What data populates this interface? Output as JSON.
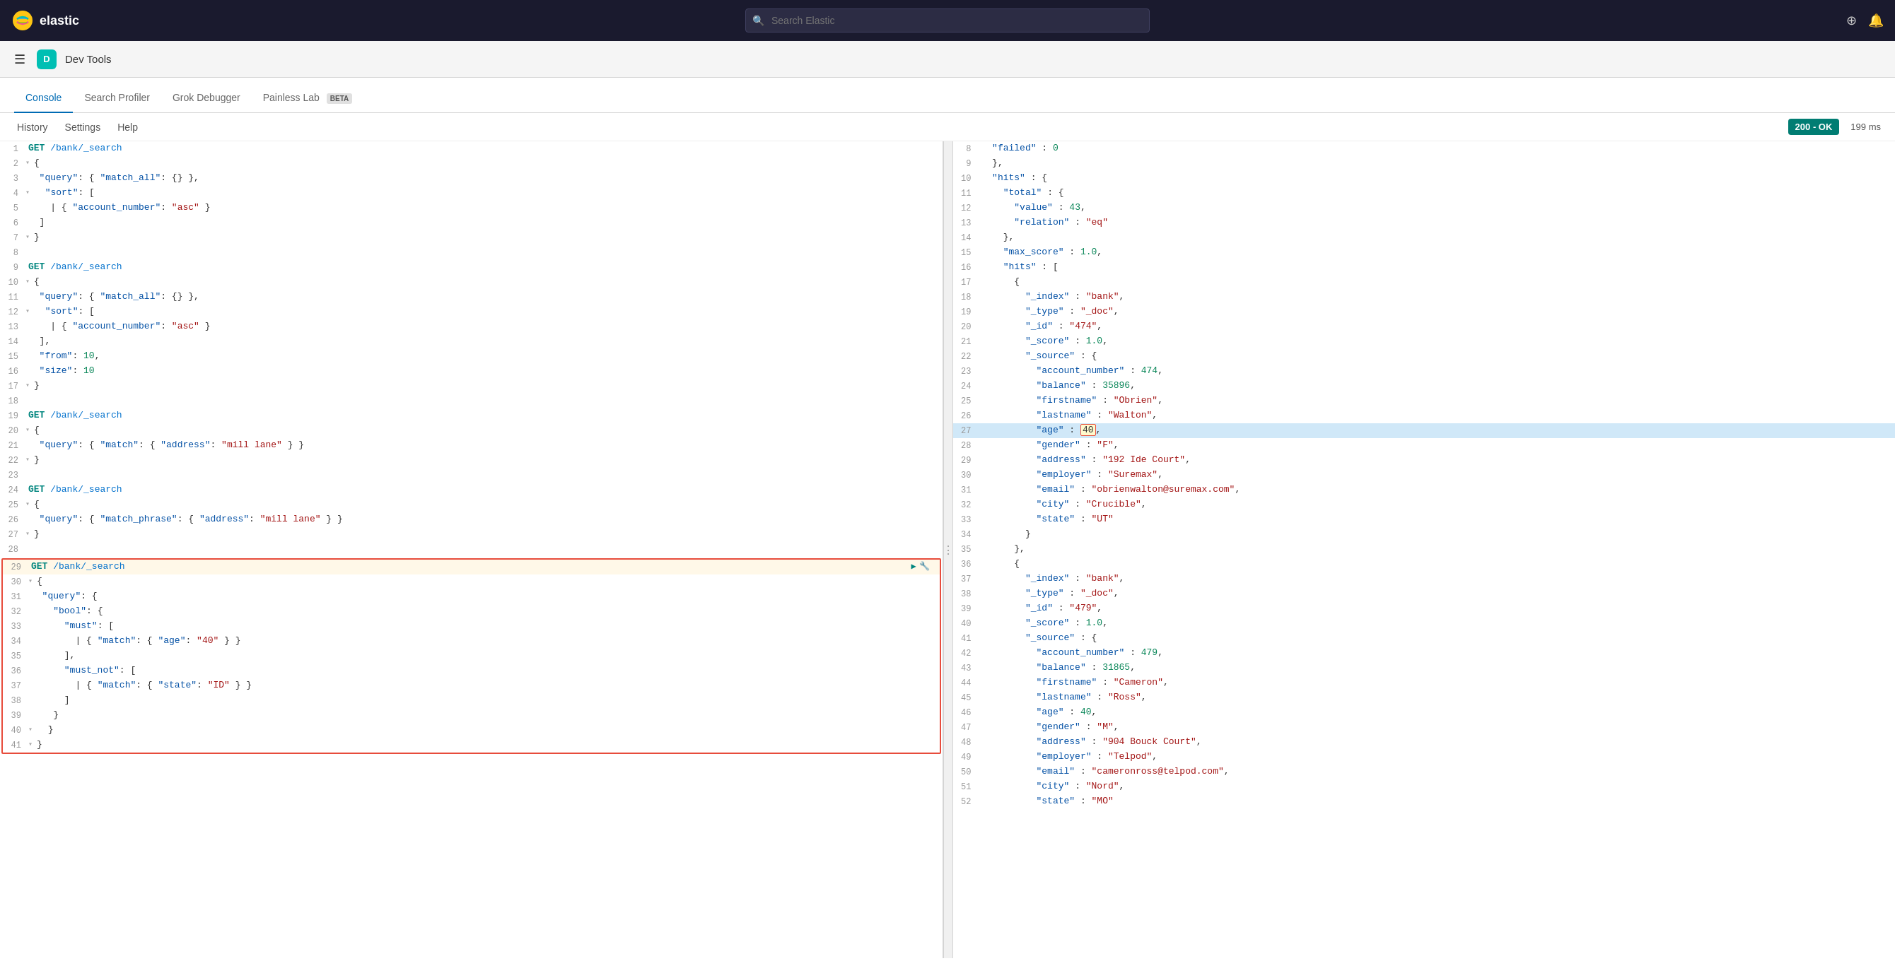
{
  "app": {
    "logo_text": "elastic",
    "search_placeholder": "Search Elastic"
  },
  "second_nav": {
    "title": "Dev Tools"
  },
  "tabs": [
    {
      "id": "console",
      "label": "Console",
      "active": true
    },
    {
      "id": "search-profiler",
      "label": "Search Profiler",
      "active": false
    },
    {
      "id": "grok-debugger",
      "label": "Grok Debugger",
      "active": false
    },
    {
      "id": "painless-lab",
      "label": "Painless Lab",
      "active": false,
      "beta": true
    }
  ],
  "toolbar": {
    "history_label": "History",
    "settings_label": "Settings",
    "help_label": "Help",
    "status_label": "200 - OK",
    "time_label": "199 ms"
  },
  "editor": {
    "lines": [
      {
        "num": 1,
        "content": "GET /bank/_search",
        "type": "method-line"
      },
      {
        "num": 2,
        "content": "{",
        "fold": true
      },
      {
        "num": 3,
        "content": "  \"query\": { \"match_all\": {} },",
        "type": "code"
      },
      {
        "num": 4,
        "content": "  \"sort\": [",
        "fold": true
      },
      {
        "num": 5,
        "content": "    { \"account_number\": \"asc\" }",
        "type": "code"
      },
      {
        "num": 6,
        "content": "  ]",
        "type": "code"
      },
      {
        "num": 7,
        "content": "}",
        "type": "code"
      },
      {
        "num": 8,
        "content": "",
        "type": "empty"
      },
      {
        "num": 9,
        "content": "GET /bank/_search",
        "type": "method-line"
      },
      {
        "num": 10,
        "content": "{",
        "fold": true
      },
      {
        "num": 11,
        "content": "  \"query\": { \"match_all\": {} },",
        "type": "code"
      },
      {
        "num": 12,
        "content": "  \"sort\": [",
        "fold": true
      },
      {
        "num": 13,
        "content": "    { \"account_number\": \"asc\" }",
        "type": "code"
      },
      {
        "num": 14,
        "content": "  ],",
        "type": "code"
      },
      {
        "num": 15,
        "content": "  \"from\": 10,",
        "type": "code"
      },
      {
        "num": 16,
        "content": "  \"size\": 10",
        "type": "code"
      },
      {
        "num": 17,
        "content": "}",
        "type": "code"
      },
      {
        "num": 18,
        "content": "",
        "type": "empty"
      },
      {
        "num": 19,
        "content": "GET /bank/_search",
        "type": "method-line"
      },
      {
        "num": 20,
        "content": "{",
        "fold": true
      },
      {
        "num": 21,
        "content": "  \"query\": { \"match\": { \"address\": \"mill lane\" } }",
        "type": "code"
      },
      {
        "num": 22,
        "content": "}",
        "type": "code"
      },
      {
        "num": 23,
        "content": "",
        "type": "empty"
      },
      {
        "num": 24,
        "content": "GET /bank/_search",
        "type": "method-line"
      },
      {
        "num": 25,
        "content": "{",
        "fold": true
      },
      {
        "num": 26,
        "content": "  \"query\": { \"match_phrase\": { \"address\": \"mill lane\" } }",
        "type": "code"
      },
      {
        "num": 27,
        "content": "}",
        "type": "code"
      },
      {
        "num": 28,
        "content": "",
        "type": "empty"
      },
      {
        "num": 29,
        "content": "GET /bank/_search",
        "type": "method-line-selected"
      },
      {
        "num": 30,
        "content": "{",
        "fold": true,
        "selected": true
      },
      {
        "num": 31,
        "content": "  \"query\": {",
        "type": "code",
        "selected": true
      },
      {
        "num": 32,
        "content": "    \"bool\": {",
        "type": "code",
        "selected": true
      },
      {
        "num": 33,
        "content": "      \"must\": [",
        "type": "code",
        "selected": true
      },
      {
        "num": 34,
        "content": "        { \"match\": { \"age\": \"40\" } }",
        "type": "code",
        "selected": true
      },
      {
        "num": 35,
        "content": "      ],",
        "type": "code",
        "selected": true
      },
      {
        "num": 36,
        "content": "      \"must_not\": [",
        "type": "code",
        "selected": true
      },
      {
        "num": 37,
        "content": "        { \"match\": { \"state\": \"ID\" } }",
        "type": "code",
        "selected": true
      },
      {
        "num": 38,
        "content": "      ]",
        "type": "code",
        "selected": true
      },
      {
        "num": 39,
        "content": "    }",
        "type": "code",
        "selected": true
      },
      {
        "num": 40,
        "content": "  }",
        "type": "code",
        "selected": true
      },
      {
        "num": 41,
        "content": "}",
        "type": "code",
        "selected": true
      }
    ]
  },
  "response": {
    "lines": [
      {
        "num": 8,
        "content": "  \"failed\" : 0"
      },
      {
        "num": 9,
        "content": "  },"
      },
      {
        "num": 10,
        "content": "  \"hits\" : {"
      },
      {
        "num": 11,
        "content": "    \"total\" : {"
      },
      {
        "num": 12,
        "content": "      \"value\" : 43,"
      },
      {
        "num": 13,
        "content": "      \"relation\" : \"eq\""
      },
      {
        "num": 14,
        "content": "    },"
      },
      {
        "num": 15,
        "content": "    \"max_score\" : 1.0,"
      },
      {
        "num": 16,
        "content": "    \"hits\" : ["
      },
      {
        "num": 17,
        "content": "      {"
      },
      {
        "num": 18,
        "content": "        \"_index\" : \"bank\","
      },
      {
        "num": 19,
        "content": "        \"_type\" : \"_doc\","
      },
      {
        "num": 20,
        "content": "        \"_id\" : \"474\","
      },
      {
        "num": 21,
        "content": "        \"_score\" : 1.0,"
      },
      {
        "num": 22,
        "content": "        \"_source\" : {"
      },
      {
        "num": 23,
        "content": "          \"account_number\" : 474,"
      },
      {
        "num": 24,
        "content": "          \"balance\" : 35896,"
      },
      {
        "num": 25,
        "content": "          \"firstname\" : \"Obrien\","
      },
      {
        "num": 26,
        "content": "          \"lastname\" : \"Walton\","
      },
      {
        "num": 27,
        "content": "          \"age\" : 40,",
        "highlighted": true
      },
      {
        "num": 28,
        "content": "          \"gender\" : \"F\","
      },
      {
        "num": 29,
        "content": "          \"address\" : \"192 Ide Court\","
      },
      {
        "num": 30,
        "content": "          \"employer\" : \"Suremax\","
      },
      {
        "num": 31,
        "content": "          \"email\" : \"obrienwalton@suremax.com\","
      },
      {
        "num": 32,
        "content": "          \"city\" : \"Crucible\","
      },
      {
        "num": 33,
        "content": "          \"state\" : \"UT\""
      },
      {
        "num": 34,
        "content": "        }"
      },
      {
        "num": 35,
        "content": "      },"
      },
      {
        "num": 36,
        "content": "      {"
      },
      {
        "num": 37,
        "content": "        \"_index\" : \"bank\","
      },
      {
        "num": 38,
        "content": "        \"_type\" : \"_doc\","
      },
      {
        "num": 39,
        "content": "        \"_id\" : \"479\","
      },
      {
        "num": 40,
        "content": "        \"_score\" : 1.0,"
      },
      {
        "num": 41,
        "content": "        \"_source\" : {"
      },
      {
        "num": 42,
        "content": "          \"account_number\" : 479,"
      },
      {
        "num": 43,
        "content": "          \"balance\" : 31865,"
      },
      {
        "num": 44,
        "content": "          \"firstname\" : \"Cameron\","
      },
      {
        "num": 45,
        "content": "          \"lastname\" : \"Ross\","
      },
      {
        "num": 46,
        "content": "          \"age\" : 40,"
      },
      {
        "num": 47,
        "content": "          \"gender\" : \"M\","
      },
      {
        "num": 48,
        "content": "          \"address\" : \"904 Bouck Court\","
      },
      {
        "num": 49,
        "content": "          \"employer\" : \"Telpod\","
      },
      {
        "num": 50,
        "content": "          \"email\" : \"cameronross@telpod.com\","
      },
      {
        "num": 51,
        "content": "          \"city\" : \"Nord\","
      },
      {
        "num": 52,
        "content": "          \"state\" : \"MO\""
      }
    ]
  }
}
